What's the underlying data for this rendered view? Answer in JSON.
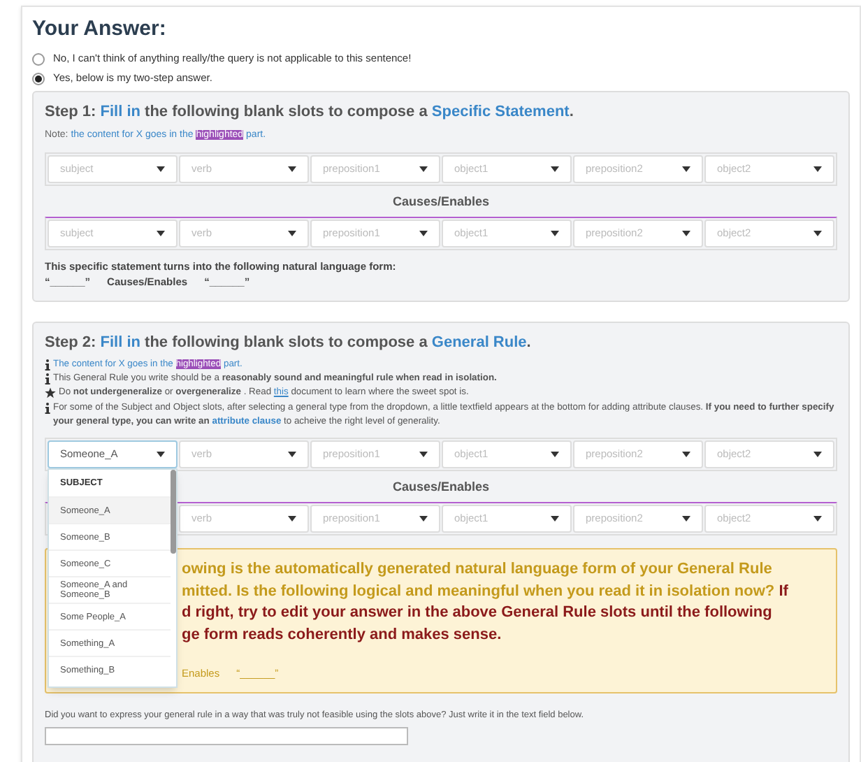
{
  "title": "Your Answer:",
  "options": [
    {
      "label": "No, I can't think of anything really/the query is not applicable to this sentence!",
      "selected": false
    },
    {
      "label": "Yes, below is my two-step answer.",
      "selected": true
    }
  ],
  "step1": {
    "heading": {
      "step": "Step 1:",
      "action": "Fill in",
      "middle": "the following blank slots to compose a",
      "target": "Specific Statement",
      "end": "."
    },
    "note": {
      "label": "Note:",
      "text": "the content for X goes in the",
      "highlight": "highlighted",
      "after": "part."
    },
    "cause_row": [
      {
        "placeholder": "subject",
        "focused": false
      },
      {
        "placeholder": "verb",
        "focused": false
      },
      {
        "placeholder": "preposition1",
        "focused": false
      },
      {
        "placeholder": "object1",
        "focused": false
      },
      {
        "placeholder": "preposition2",
        "focused": false
      },
      {
        "placeholder": "object2",
        "focused": false
      }
    ],
    "connector": "Causes/Enables",
    "effect_row": [
      {
        "placeholder": "subject",
        "focused": false
      },
      {
        "placeholder": "verb",
        "focused": false
      },
      {
        "placeholder": "preposition1",
        "focused": false
      },
      {
        "placeholder": "object1",
        "focused": false
      },
      {
        "placeholder": "preposition2",
        "focused": false
      },
      {
        "placeholder": "object2",
        "focused": false
      }
    ],
    "form_intro": "This specific statement turns into the following natural language form:",
    "form": [
      "“______”",
      "Causes/Enables",
      "“______”"
    ]
  },
  "step2": {
    "heading": {
      "step": "Step 2:",
      "action": "Fill in",
      "middle": "the following blank slots to compose a",
      "target": "General Rule",
      "end": "."
    },
    "notes": [
      {
        "kind": "hint",
        "text": "The content for X goes in the",
        "highlight": "highlighted",
        "after": "part."
      },
      {
        "kind": "info",
        "text": "This General Rule you write should be a **reasonably sound and meaningful rule when read in isolation.**"
      },
      {
        "kind": "star",
        "text": "Do **not undergeneralize** or **overgeneralize** . Read",
        "link": "this",
        "after": "document to learn where the sweet spot is."
      },
      {
        "kind": "info",
        "text": "For some of the Subject and Object slots, after selecting a general type from the dropdown, a little textfield appears at the bottom for adding attribute clauses. **If you need to further specify your general type, you can write an**",
        "link": "attribute clause",
        "after": "to acheive the right level of generality."
      }
    ],
    "cause_row": [
      {
        "value": "Someone_A",
        "focused": true
      },
      {
        "placeholder": "verb",
        "focused": false
      },
      {
        "placeholder": "preposition1",
        "focused": false
      },
      {
        "placeholder": "object1",
        "focused": false
      },
      {
        "placeholder": "preposition2",
        "focused": false
      },
      {
        "placeholder": "object2",
        "focused": false
      }
    ],
    "menu": {
      "header": "SUBJECT",
      "items": [
        {
          "label": "Someone_A",
          "selected": true
        },
        {
          "label": "Someone_B",
          "selected": false
        },
        {
          "label": "Someone_C",
          "selected": false
        },
        {
          "label": "Someone_A and Someone_B",
          "selected": false
        },
        {
          "label": "Some People_A",
          "selected": false
        },
        {
          "label": "Something_A",
          "selected": false
        },
        {
          "label": "Something_B",
          "selected": false
        }
      ]
    },
    "connector": "Causes/Enables",
    "effect_row": [
      {
        "placeholder": "verb",
        "focused": false
      },
      {
        "placeholder": "preposition1",
        "focused": false
      },
      {
        "placeholder": "object1",
        "focused": false
      },
      {
        "placeholder": "preposition2",
        "focused": false
      },
      {
        "placeholder": "object2",
        "focused": false
      }
    ],
    "feedback": [
      {
        "statement": "owing is the automatically generated natural language form of your General Rule"
      },
      {
        "statement": "mitted. Is the following logical and meaningful when you read it in isolation now?",
        "warning": "If"
      },
      {
        "warning": "d right, try to edit your answer in the above General Rule slots until the following"
      },
      {
        "warning": "ge form reads coherently and makes sense."
      }
    ],
    "form": [
      "Enables",
      "“______”"
    ],
    "free_text_prompt": "Did you want to express your general rule in a way that was truly not feasible using the slots above? Just write it in the text field below."
  }
}
